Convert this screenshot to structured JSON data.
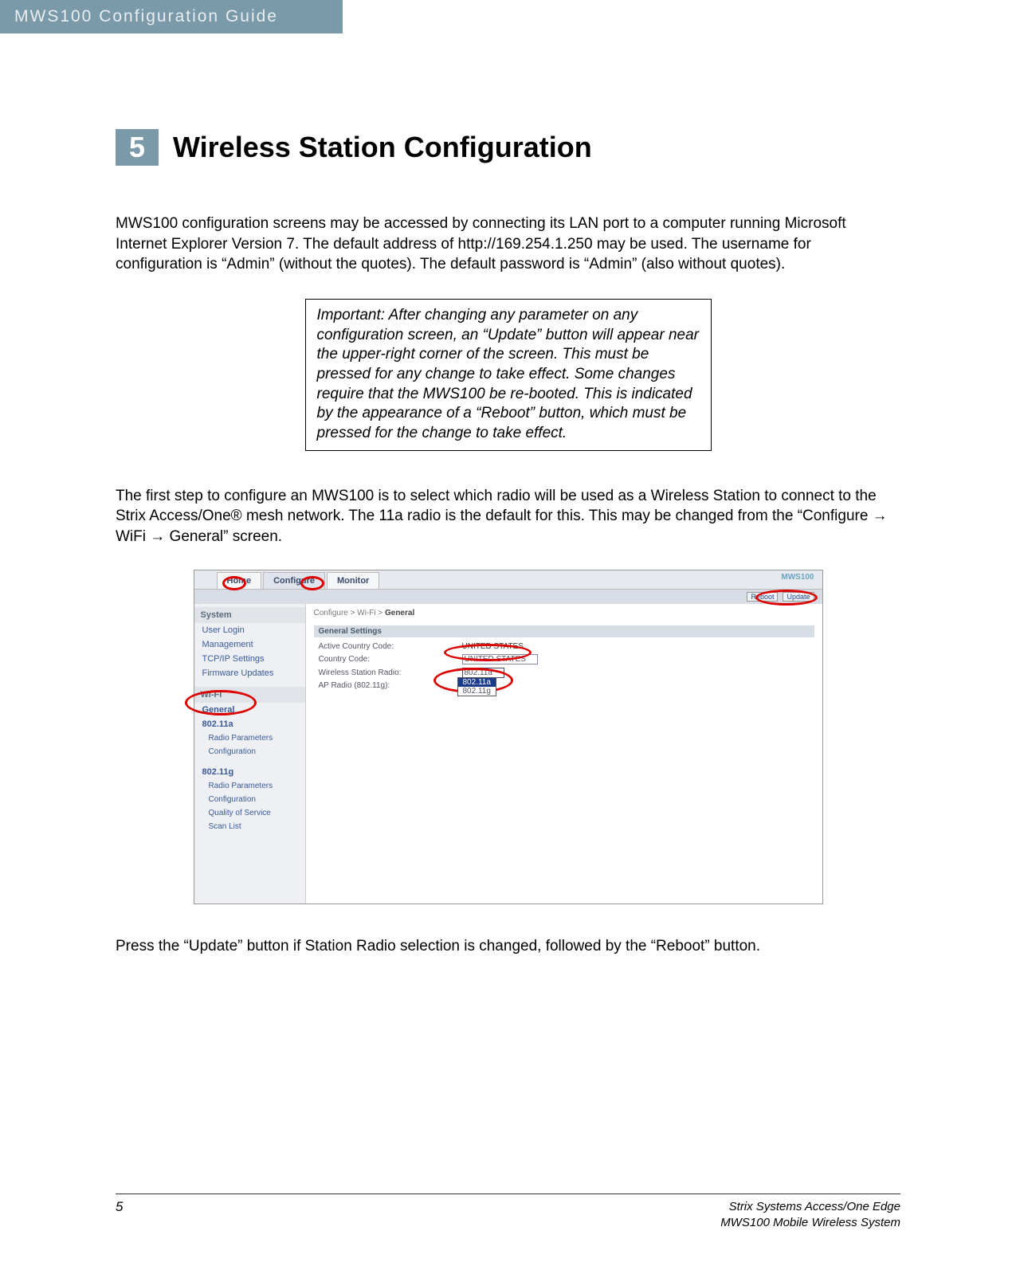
{
  "header": {
    "title": "MWS100 Configuration Guide"
  },
  "chapter": {
    "number": "5",
    "title": "Wireless Station Configuration"
  },
  "body": {
    "p1": "MWS100 configuration screens may be accessed by connecting its LAN port to a computer running Microsoft Internet Explorer Version 7. The default address of http://169.254.1.250 may be used. The username for configuration is “Admin” (without the quotes). The default password is “Admin” (also without quotes).",
    "callout": "Important: After changing any parameter on any configuration screen, an “Update” button will appear near the upper-right corner of the screen. This must be pressed for any change to take effect. Some changes require that the MWS100 be re-booted. This is indicated by the appearance of a “Reboot” button, which must be pressed for the change to take effect.",
    "p2": "The first step to configure an MWS100 is to select which radio will be used as a Wireless Station to connect to the Strix Access/One® mesh network. The 11a radio is the default for this. This may be changed from the “Configure → WiFi → General” screen.",
    "p3": "Press the “Update” button if Station Radio selection is changed, followed by the “Reboot” button."
  },
  "screenshot": {
    "tabs": {
      "home": "Home",
      "configure": "Configure",
      "monitor": "Monitor"
    },
    "brand": "MWS100",
    "topbuttons": {
      "reboot": "Reboot",
      "update": "Update"
    },
    "sidebar": {
      "system": "System",
      "userlogin": "User Login",
      "management": "Management",
      "tcpip": "TCP/IP Settings",
      "firmware": "Firmware Updates",
      "wifi": "Wi-Fi",
      "general": "General",
      "r11a": "802.11a",
      "radioparams": "Radio Parameters",
      "configuration": "Configuration",
      "r11g": "802.11g",
      "qos": "Quality of Service",
      "scanlist": "Scan List"
    },
    "main": {
      "crumb_pre": "Configure > Wi-Fi > ",
      "crumb_cur": "General",
      "settingsHeader": "General Settings",
      "row1": {
        "label": "Active Country Code:",
        "value": "UNITED STATES"
      },
      "row2": {
        "label": "Country Code:",
        "value": "UNITED STATES"
      },
      "row3": {
        "label": "Wireless Station Radio:",
        "value": "802.11a"
      },
      "row4": {
        "label": "AP Radio (802.11g):"
      },
      "dropdown": {
        "opt1": "802.11a",
        "opt2": "802.11g"
      }
    }
  },
  "footer": {
    "page": "5",
    "right1": "Strix Systems Access/One Edge",
    "right2": "MWS100 Mobile Wireless System"
  }
}
